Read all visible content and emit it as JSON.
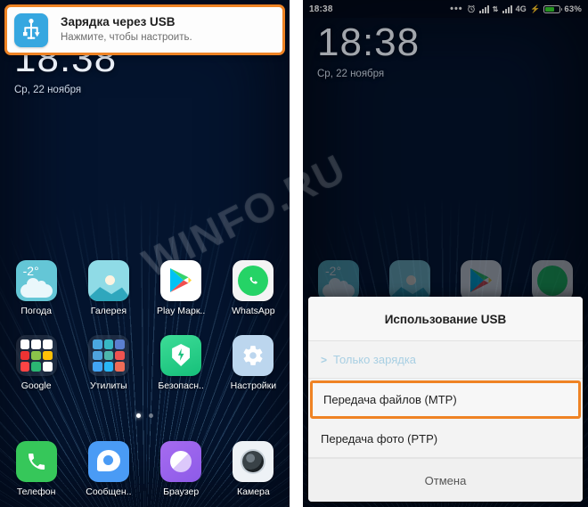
{
  "watermark": "WINFO.RU",
  "left_phone": {
    "notification": {
      "icon": "usb-icon",
      "title": "Зарядка через USB",
      "subtitle": "Нажмите, чтобы настроить."
    },
    "lock": {
      "time": "18:38",
      "date": "Ср, 22 ноября"
    },
    "home_rows": [
      [
        {
          "label": "Погода",
          "icon": "weather-icon",
          "badge": "-2°"
        },
        {
          "label": "Галерея",
          "icon": "gallery-icon"
        },
        {
          "label": "Play Марк..",
          "icon": "play-store-icon"
        },
        {
          "label": "WhatsApp",
          "icon": "whatsapp-icon"
        }
      ],
      [
        {
          "label": "Google",
          "icon": "google-folder-icon"
        },
        {
          "label": "Утилиты",
          "icon": "utilities-folder-icon"
        },
        {
          "label": "Безопасн..",
          "icon": "security-shield-icon"
        },
        {
          "label": "Настройки",
          "icon": "gear-icon"
        }
      ]
    ],
    "dock": [
      {
        "label": "Телефон",
        "icon": "phone-icon"
      },
      {
        "label": "Сообщен..",
        "icon": "messages-icon"
      },
      {
        "label": "Браузер",
        "icon": "browser-icon"
      },
      {
        "label": "Камера",
        "icon": "camera-icon"
      }
    ],
    "page_dots": {
      "count": 2,
      "active": 0
    }
  },
  "right_phone": {
    "status_bar": {
      "time": "18:38",
      "overflow_dots": "•••",
      "alarm_icon": "alarm-clock-icon",
      "signal_1_icon": "signal-bars-icon",
      "data_icon": "data-transfer-icon",
      "signal_2_icon": "signal-bars-icon",
      "network": "4G",
      "charging_icon": "lightning-bolt-icon",
      "battery_icon": "battery-icon",
      "battery_percent": "63%",
      "battery_level": 63
    },
    "lock": {
      "time": "18:38",
      "date": "Ср, 22 ноября"
    },
    "dialog": {
      "title": "Использование USB",
      "options": [
        {
          "label": "Только зарядка",
          "chevron": ">",
          "state": "current",
          "highlighted": false
        },
        {
          "label": "Передача файлов (MTP)",
          "state": "option",
          "highlighted": true
        },
        {
          "label": "Передача фото (PTP)",
          "state": "option",
          "highlighted": false
        }
      ],
      "cancel_label": "Отмена"
    }
  },
  "colors": {
    "highlight_orange": "#ef8324",
    "accent_blue": "#36a7e0",
    "battery_green": "#38d430",
    "dialog_bg": "#f3f3f3"
  }
}
